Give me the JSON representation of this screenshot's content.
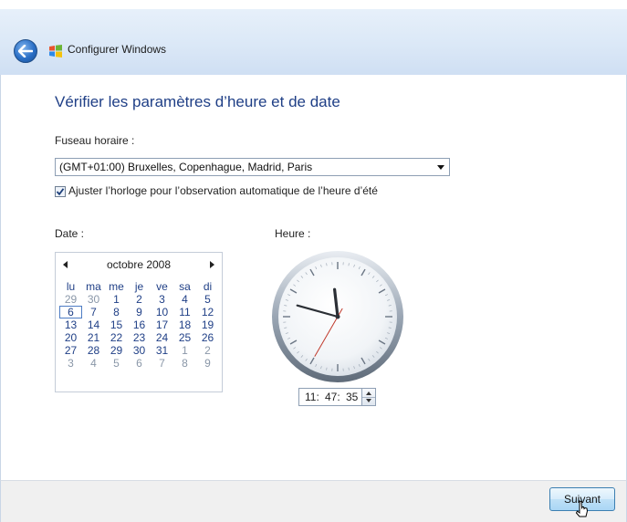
{
  "window": {
    "title": "Configurer Windows"
  },
  "page": {
    "title": "Vérifier les paramètres d’heure et de date"
  },
  "timezone": {
    "label": "Fuseau horaire :",
    "selected": "(GMT+01:00) Bruxelles, Copenhague, Madrid, Paris"
  },
  "dst": {
    "checked": true,
    "label": "Ajuster l’horloge pour l’observation automatique de l’heure d’été"
  },
  "date": {
    "label": "Date :",
    "month_title": "octobre 2008",
    "weekdays": [
      "lu",
      "ma",
      "me",
      "je",
      "ve",
      "sa",
      "di"
    ],
    "days": [
      [
        "29",
        "30",
        "1",
        "2",
        "3",
        "4",
        "5"
      ],
      [
        "6",
        "7",
        "8",
        "9",
        "10",
        "11",
        "12"
      ],
      [
        "13",
        "14",
        "15",
        "16",
        "17",
        "18",
        "19"
      ],
      [
        "20",
        "21",
        "22",
        "23",
        "24",
        "25",
        "26"
      ],
      [
        "27",
        "28",
        "29",
        "30",
        "31",
        "1",
        "2"
      ],
      [
        "3",
        "4",
        "5",
        "6",
        "7",
        "8",
        "9"
      ]
    ],
    "selected_day": "6"
  },
  "time": {
    "label": "Heure :",
    "hours": "11:",
    "minutes": "47:",
    "seconds": "35"
  },
  "footer": {
    "next_label": "Suivant"
  },
  "icons": {
    "back": "back-arrow-icon",
    "app": "windows-flag-icon",
    "cursor": "mouse-pointer-icon"
  }
}
